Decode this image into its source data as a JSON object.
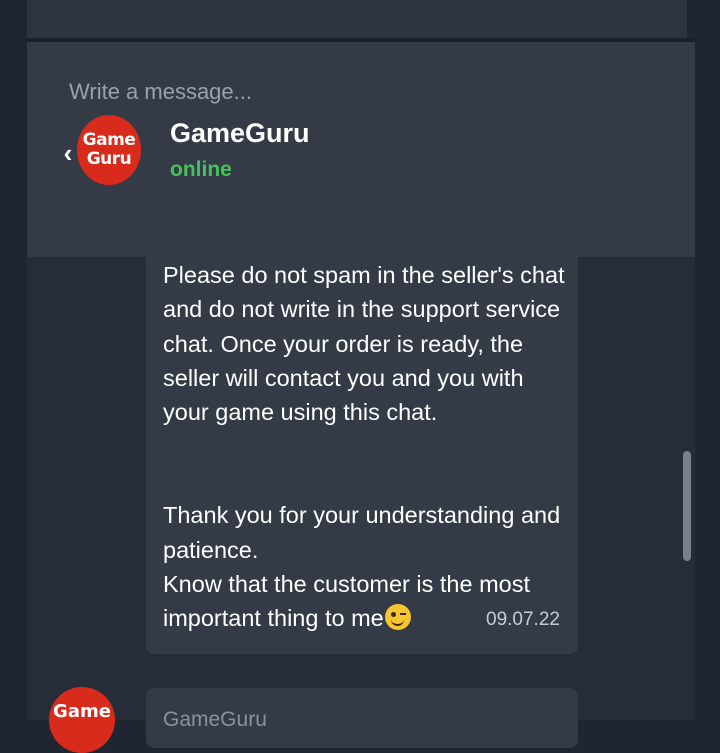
{
  "composer": {
    "placeholder": "Write a message..."
  },
  "header": {
    "seller_name": "GameGuru",
    "status": "online",
    "avatar_text_top": "Game",
    "avatar_text_bottom": "Guru"
  },
  "messages": [
    {
      "paragraph_1": "Please do not spam in the seller's chat and do not write in the support service chat. Once your order is ready, the seller will contact you and you with your game using this chat.",
      "paragraph_2a": "Thank you for your understanding and patience.",
      "paragraph_2b": "Know that the customer is the most important thing to me",
      "emoji": "winking-face-icon",
      "time": "09.07.22"
    },
    {
      "avatar_text": "Game",
      "sender": "GameGuru"
    }
  ],
  "colors": {
    "background": "#1f2631",
    "panel": "#343b47",
    "online": "#46c25a",
    "avatar": "#d92b1c"
  }
}
